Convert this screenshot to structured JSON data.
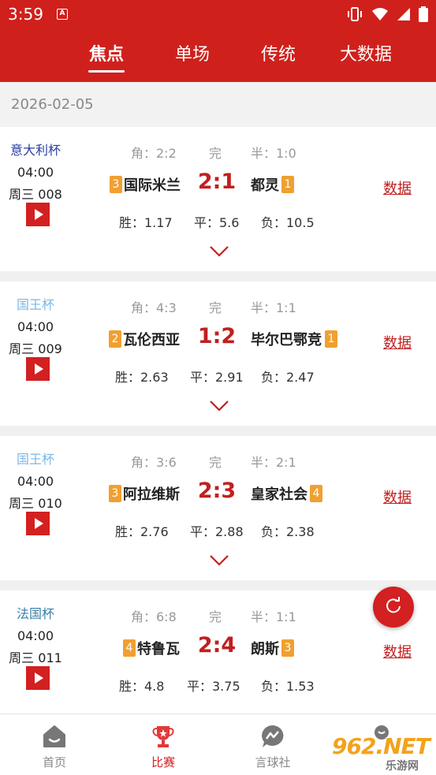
{
  "status_bar": {
    "time": "3:59",
    "app_icon": "A"
  },
  "tabs": [
    {
      "label": "焦点",
      "active": true
    },
    {
      "label": "单场",
      "active": false
    },
    {
      "label": "传统",
      "active": false
    },
    {
      "label": "大数据",
      "active": false
    }
  ],
  "date": "2026-02-05",
  "matches": [
    {
      "league": "意大利杯",
      "league_color": "#2a3fa5",
      "time": "04:00",
      "day_no": "周三 008",
      "corner": "角：2:2",
      "status": "完",
      "half": "半：1:0",
      "home_rank": "3",
      "home": "国际米兰",
      "score": "2:1",
      "away": "都灵",
      "away_rank": "1",
      "win": "胜：1.17",
      "draw": "平：5.6",
      "lose": "负：10.5",
      "data_label": "数据"
    },
    {
      "league": "国王杯",
      "league_color": "#7ab8e8",
      "time": "04:00",
      "day_no": "周三 009",
      "corner": "角：4:3",
      "status": "完",
      "half": "半：1:1",
      "home_rank": "2",
      "home": "瓦伦西亚",
      "score": "1:2",
      "away": "毕尔巴鄂竞",
      "away_rank": "1",
      "win": "胜：2.63",
      "draw": "平：2.91",
      "lose": "负：2.47",
      "data_label": "数据"
    },
    {
      "league": "国王杯",
      "league_color": "#7ab8e8",
      "time": "04:00",
      "day_no": "周三 010",
      "corner": "角：3:6",
      "status": "完",
      "half": "半：2:1",
      "home_rank": "3",
      "home": "阿拉维斯",
      "score": "2:3",
      "away": "皇家社会",
      "away_rank": "4",
      "win": "胜：2.76",
      "draw": "平：2.88",
      "lose": "负：2.38",
      "data_label": "数据"
    },
    {
      "league": "法国杯",
      "league_color": "#3a7fa8",
      "time": "04:00",
      "day_no": "周三 011",
      "corner": "角：6:8",
      "status": "完",
      "half": "半：1:1",
      "home_rank": "4",
      "home": "特鲁瓦",
      "score": "2:4",
      "away": "朗斯",
      "away_rank": "3",
      "win": "胜：4.8",
      "draw": "平：3.75",
      "lose": "负：1.53",
      "data_label": "数据"
    }
  ],
  "bottom_nav": [
    {
      "label": "首页",
      "icon": "home-icon",
      "active": false
    },
    {
      "label": "比赛",
      "icon": "trophy-icon",
      "active": true
    },
    {
      "label": "言球社",
      "icon": "chat-icon",
      "active": false
    },
    {
      "label": "",
      "icon": "profile-icon",
      "active": false
    }
  ],
  "watermark": {
    "main": "962.NET",
    "sub": "乐游网"
  },
  "colors": {
    "brand_red": "#d0201c",
    "rank_orange": "#f0a030",
    "score_red": "#c21f1f"
  }
}
